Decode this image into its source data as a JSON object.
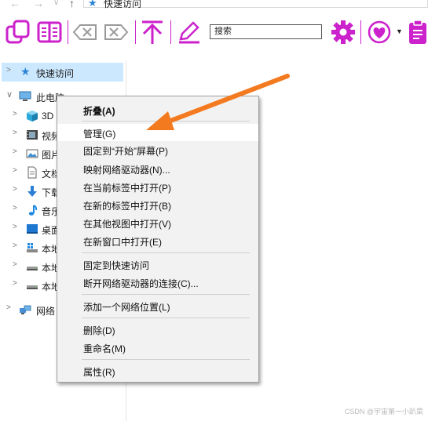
{
  "address_bar": {
    "back_glyph": "←",
    "forward_glyph": "→",
    "history_glyph": "∨",
    "up_glyph": "↑",
    "location_icon": "star-pin-icon",
    "location": "快速访问"
  },
  "toolbar": {
    "accent_color": "#cc22cc",
    "search_placeholder": "搜索",
    "icons": [
      "copy-icon",
      "columns-icon",
      "backspace-left-icon",
      "backspace-right-icon",
      "upload-icon",
      "pencil-icon",
      "gear-icon",
      "heart-icon",
      "clipboard-icon"
    ]
  },
  "nav": {
    "quick_access": "快速访问",
    "this_pc": "此电脑",
    "items": [
      {
        "label": "3D",
        "icon": "cube-3d-icon"
      },
      {
        "label": "视频",
        "icon": "film-icon"
      },
      {
        "label": "图片",
        "icon": "picture-icon"
      },
      {
        "label": "文档",
        "icon": "document-icon"
      },
      {
        "label": "下载",
        "icon": "download-arrow-icon"
      },
      {
        "label": "音乐",
        "icon": "music-note-icon"
      },
      {
        "label": "桌面",
        "icon": "desktop-icon"
      },
      {
        "label": "本地",
        "icon": "windows-drive-icon"
      },
      {
        "label": "本地",
        "icon": "drive-icon"
      },
      {
        "label": "本地",
        "icon": "drive-icon"
      }
    ],
    "network": "网络"
  },
  "context_menu": {
    "items": [
      {
        "label": "折叠(A)",
        "bold": true
      },
      {
        "label": "管理(G)",
        "highlighted": true
      },
      {
        "label": "固定到“开始”屏幕(P)"
      },
      {
        "label": "映射网络驱动器(N)..."
      },
      {
        "label": "在当前标签中打开(P)"
      },
      {
        "label": "在新的标签中打开(B)"
      },
      {
        "label": "在其他视图中打开(V)"
      },
      {
        "label": "在新窗口中打开(E)"
      },
      {
        "label": "固定到快速访问"
      },
      {
        "label": "断开网络驱动器的连接(C)..."
      },
      {
        "label": "添加一个网络位置(L)"
      },
      {
        "label": "删除(D)"
      },
      {
        "label": "重命名(M)"
      },
      {
        "label": "属性(R)"
      }
    ]
  },
  "annotation": {
    "arrow_color": "#f47a20"
  },
  "watermark": "CSDN @宇宙第一小趴菜"
}
